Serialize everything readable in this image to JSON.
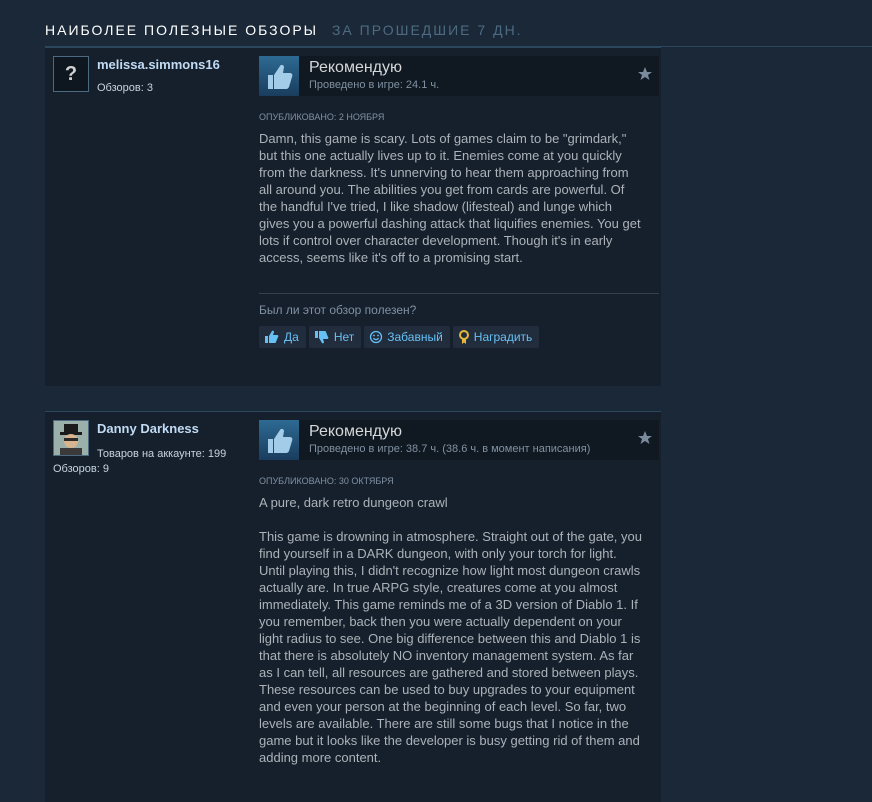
{
  "header": {
    "title": "НАИБОЛЕЕ ПОЛЕЗНЫЕ ОБЗОРЫ",
    "subtitle": "ЗА ПРОШЕДШИЕ 7 ДН."
  },
  "reviews": [
    {
      "author": "melissa.simmons16",
      "avatar_glyph": "?",
      "stats": [
        "Обзоров: 3"
      ],
      "recommendation": "Рекомендую",
      "hours": "Проведено в игре: 24.1 ч.",
      "posted": "ОПУБЛИКОВАНО: 2 НОЯБРЯ",
      "paragraphs": [
        "Damn, this game is scary. Lots of games claim to be \"grimdark,\" but this one actually lives up to it. Enemies come at you quickly from the darkness. It's unnerving to hear them approaching from all around you. The abilities you get from cards are powerful. Of the handful I've tried, I like shadow (lifesteal) and lunge which gives you a powerful dashing attack that liquifies enemies. You get lots if control over character development. Though it's in early access, seems like it's off to a promising start."
      ],
      "helpful_question": "Был ли этот обзор полезен?",
      "buttons": {
        "yes": "Да",
        "no": "Нет",
        "funny": "Забавный",
        "award": "Наградить"
      }
    },
    {
      "author": "Danny Darkness",
      "stats": [
        "Товаров на аккаунте: 199",
        "Обзоров: 9"
      ],
      "recommendation": "Рекомендую",
      "hours": "Проведено в игре: 38.7 ч. (38.6 ч. в момент написания)",
      "posted": "ОПУБЛИКОВАНО: 30 ОКТЯБРЯ",
      "paragraphs": [
        "A pure, dark retro dungeon crawl",
        "This game is drowning in atmosphere. Straight out of the gate, you find yourself in a DARK dungeon, with only your torch for light. Until playing this, I didn't recognize how light most dungeon crawls actually are. In true ARPG style, creatures come at you almost immediately. This game reminds me of a 3D version of Diablo 1. If you remember, back then you were actually dependent on your light radius to see. One big difference between this and Diablo 1 is that there is absolutely NO inventory management system. As far as I can tell, all resources are gathered and stored between plays. These resources can be used to buy upgrades to your equipment and even your person at the beginning of each level. So far, two levels are available. There are still some bugs that I notice in the game but it looks like the developer is busy getting rid of them and adding more content."
      ]
    }
  ]
}
